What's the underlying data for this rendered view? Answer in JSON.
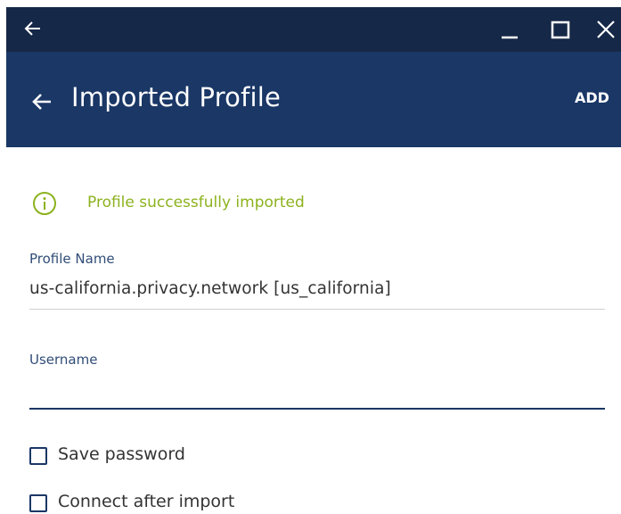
{
  "titlebar": {
    "back_icon": "arrow-left-icon",
    "minimize_icon": "minimize-icon",
    "maximize_icon": "maximize-icon",
    "close_icon": "close-icon",
    "background": "#162847"
  },
  "appbar": {
    "title": "Imported Profile",
    "action_label": "ADD",
    "background": "#1a3766"
  },
  "status": {
    "icon": "info-circle-icon",
    "message": "Profile successfully imported",
    "color": "#8cb21e"
  },
  "form": {
    "profile_name_label": "Profile Name",
    "profile_name_value": "us-california.privacy.network [us_california]",
    "username_label": "Username",
    "username_value": ""
  },
  "options": [
    {
      "label": "Save password",
      "checked": false
    },
    {
      "label": "Connect after import",
      "checked": false
    }
  ]
}
